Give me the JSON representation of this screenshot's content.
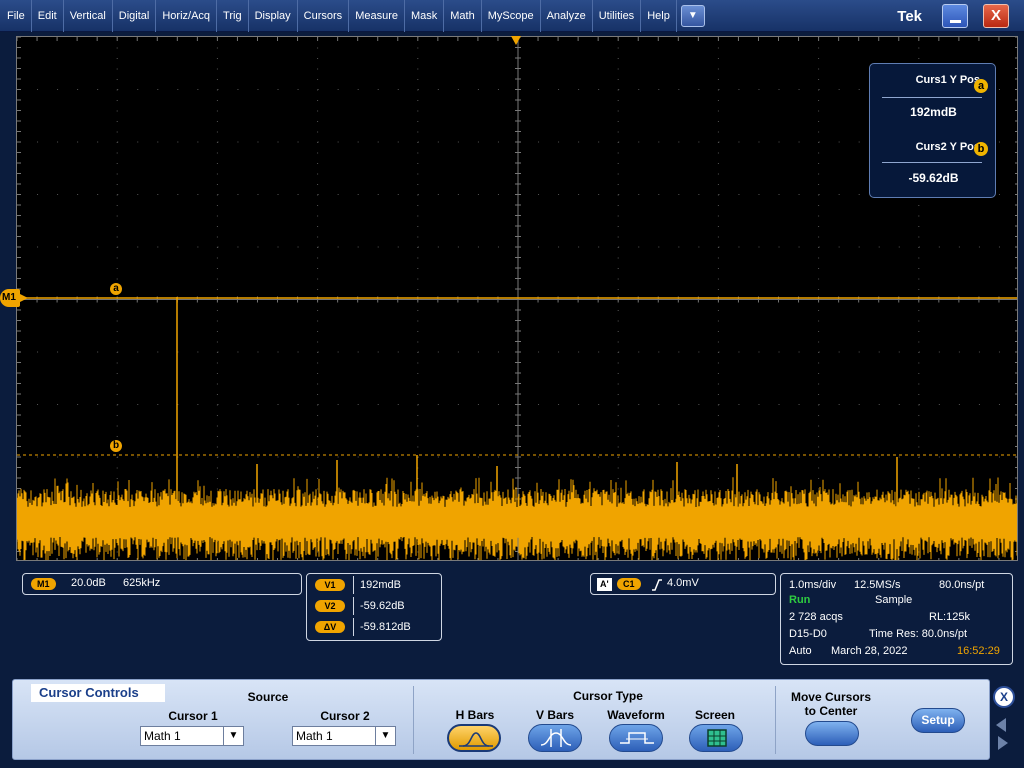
{
  "menu": {
    "items": [
      "File",
      "Edit",
      "Vertical",
      "Digital",
      "Horiz/Acq",
      "Trig",
      "Display",
      "Cursors",
      "Measure",
      "Mask",
      "Math",
      "MyScope",
      "Analyze",
      "Utilities",
      "Help"
    ],
    "dropdown_icon": "▼"
  },
  "brand": {
    "logo": "Tek"
  },
  "window": {
    "minimize_icon": "minimize-icon",
    "close_glyph": "X"
  },
  "scope": {
    "m1_marker": "M1",
    "cursor_a_label": "a",
    "cursor_b_label": "b",
    "waveform_color": "#f0a400"
  },
  "cursor_popup": {
    "curs1_title": "Curs1 Y Pos",
    "curs1_badge": "a",
    "curs1_value": "192mdB",
    "curs2_title": "Curs2 Y Pos",
    "curs2_badge": "b",
    "curs2_value": "-59.62dB"
  },
  "info": {
    "m1_badge": "M1",
    "m1_scale": "20.0dB",
    "m1_freq": "625kHz",
    "readouts": [
      {
        "label": "V1",
        "value": "192mdB"
      },
      {
        "label": "V2",
        "value": "-59.62dB"
      },
      {
        "label": "ΔV",
        "value": "-59.812dB"
      }
    ],
    "trigger": {
      "a_badge": "A'",
      "c1_badge": "C1",
      "level": "4.0mV"
    },
    "acq": {
      "timebase": "1.0ms/div",
      "sample_rate": "12.5MS/s",
      "resolution": "80.0ns/pt",
      "state": "Run",
      "mode": "Sample",
      "acqs": "2 728 acqs",
      "record_length": "RL:125k",
      "channels": "D15-D0",
      "time_res": "Time Res: 80.0ns/pt",
      "trigger_mode": "Auto",
      "date": "March 28, 2022",
      "time": "16:52:29",
      "run_color": "#2ecc40",
      "time_color": "#f0a400"
    }
  },
  "controls": {
    "title": "Cursor Controls",
    "source_label": "Source",
    "cursor1_label": "Cursor 1",
    "cursor1_value": "Math 1",
    "cursor2_label": "Cursor 2",
    "cursor2_value": "Math 1",
    "cursor_type_label": "Cursor Type",
    "types": [
      "H Bars",
      "V Bars",
      "Waveform",
      "Screen"
    ],
    "active_type": "H Bars",
    "move_cursors_label": "Move Cursors\nto Center",
    "setup_label": "Setup",
    "close_glyph": "X"
  }
}
